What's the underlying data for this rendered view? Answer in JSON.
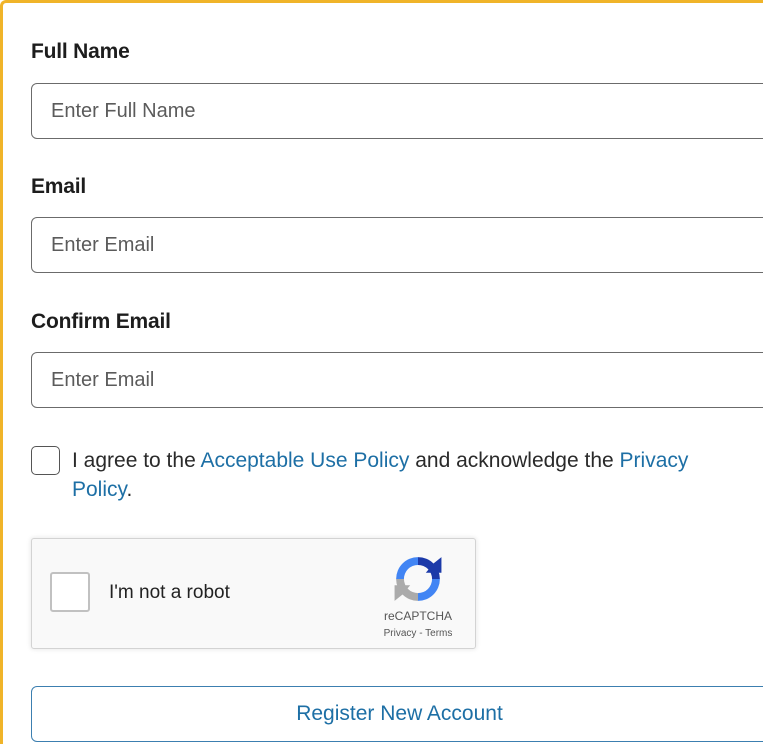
{
  "form": {
    "full_name": {
      "label": "Full Name",
      "placeholder": "Enter Full Name",
      "value": ""
    },
    "email": {
      "label": "Email",
      "placeholder": "Enter Email",
      "value": ""
    },
    "confirm_email": {
      "label": "Confirm Email",
      "placeholder": "Enter Email",
      "value": ""
    },
    "agreement": {
      "checked": false,
      "text_before": "I agree to the ",
      "aup_link": "Acceptable Use Policy",
      "text_middle": " and acknowledge the ",
      "privacy_link": "Privacy Policy",
      "text_after": "."
    },
    "recaptcha": {
      "label": "I'm not a robot",
      "brand": "reCAPTCHA",
      "privacy_link": "Privacy",
      "separator": " - ",
      "terms_link": "Terms",
      "icon": "recaptcha-logo-icon"
    },
    "submit_label": "Register New Account"
  },
  "colors": {
    "panel_border": "#f0b429",
    "link": "#1d6fa5",
    "button_border": "#3c7fb0"
  }
}
